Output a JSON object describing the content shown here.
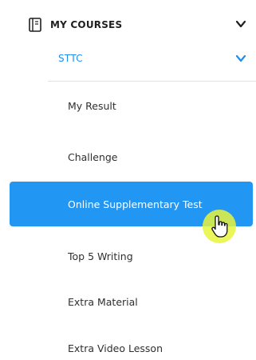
{
  "sidebar": {
    "section": {
      "title": "MY COURSES",
      "icon": "book-icon",
      "expand_icon": "chevron-down-icon"
    },
    "course": {
      "title": "STTC",
      "expand_icon": "chevron-down-icon"
    },
    "items": [
      {
        "label": "My Result",
        "active": false
      },
      {
        "label": "Challenge",
        "active": false
      },
      {
        "label": "Online Supplementary Test",
        "active": true
      },
      {
        "label": "Top 5 Writing",
        "active": false
      },
      {
        "label": "Extra Material",
        "active": false
      },
      {
        "label": "Extra Video Lesson",
        "active": false
      }
    ]
  },
  "colors": {
    "accent": "#2196f3",
    "link": "#1f8ef1",
    "text": "#2f2f2f",
    "cursor_highlight": "#e8f53c"
  }
}
